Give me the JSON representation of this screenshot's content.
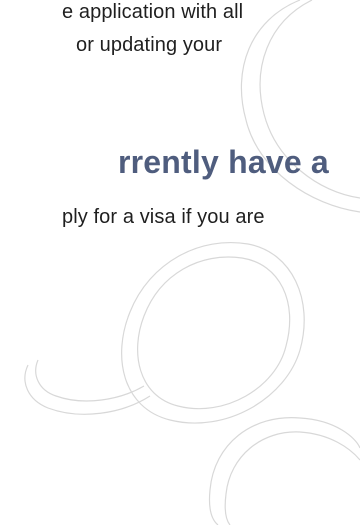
{
  "content": {
    "line_1": "e application with all",
    "line_2": "or updating your",
    "heading": "rrently have a",
    "line_3": "ply for a visa if you are"
  },
  "colors": {
    "heading": "#4f5d7e",
    "body_text": "#1f1f1f",
    "decor_stroke": "#d8d8d8"
  }
}
